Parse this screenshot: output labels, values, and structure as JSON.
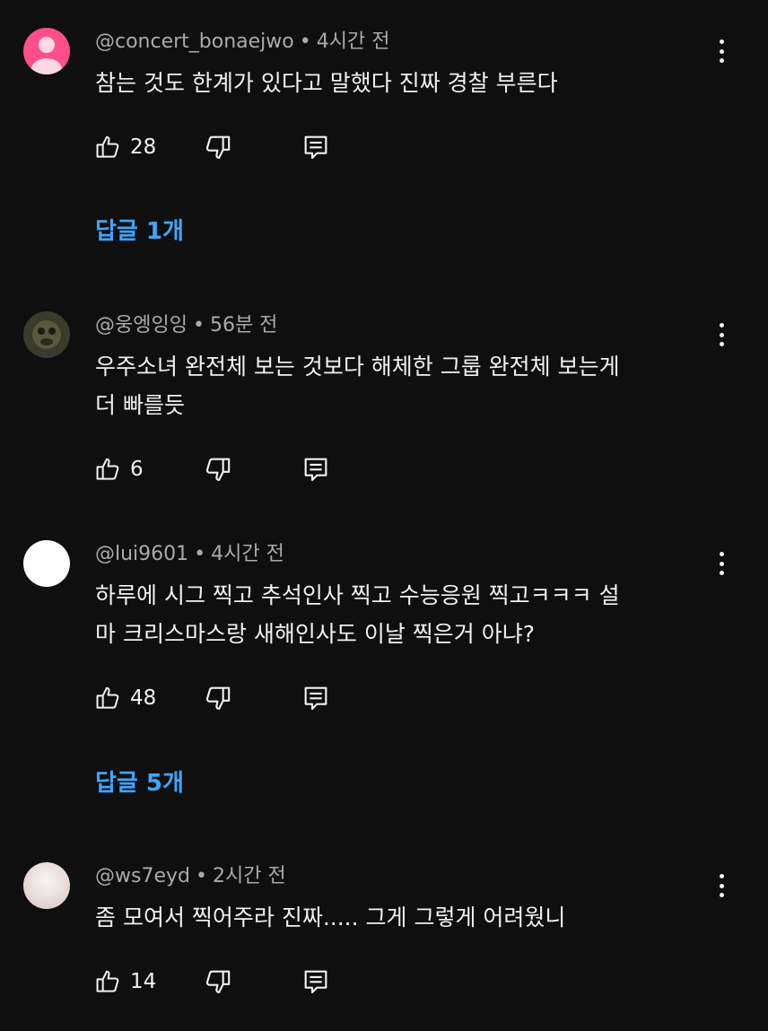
{
  "comments": [
    {
      "author": "@concert_bonaejwo",
      "time": "4시간 전",
      "text": "참는 것도 한계가 있다고 말했다 진짜 경찰 부른다",
      "likes": "28",
      "replies_label": "답글 1개",
      "avatar_color": "#ff4e8a"
    },
    {
      "author": "@웅엥잉잉",
      "time": "56분 전",
      "text": "우주소녀 완전체 보는 것보다 해체한 그룹 완전체 보는게\n더 빠를듯",
      "likes": "6",
      "replies_label": "",
      "avatar_color": "#3b3a2c"
    },
    {
      "author": "@lui9601",
      "time": "4시간 전",
      "text": "하루에 시그 찍고 추석인사 찍고 수능응원 찍고ㅋㅋㅋ 설\n마 크리스마스랑 새해인사도 이날 찍은거 아냐?",
      "likes": "48",
      "replies_label": "답글 5개",
      "avatar_color": "#ffffff"
    },
    {
      "author": "@ws7eyd",
      "time": "2시간 전",
      "text": "좀 모여서 찍어주라 진짜..... 그게 그렇게 어려웠니",
      "likes": "14",
      "replies_label": "",
      "avatar_color": "#efe3e3"
    }
  ],
  "meta_separator": "•",
  "icons": {
    "like": "thumbs-up-icon",
    "dislike": "thumbs-down-icon",
    "reply": "reply-icon",
    "more": "more-vert-icon"
  },
  "colors": {
    "background": "#0f0f0f",
    "text": "#f1f1f1",
    "meta": "#aaaaaa",
    "link": "#3ea6ff"
  }
}
